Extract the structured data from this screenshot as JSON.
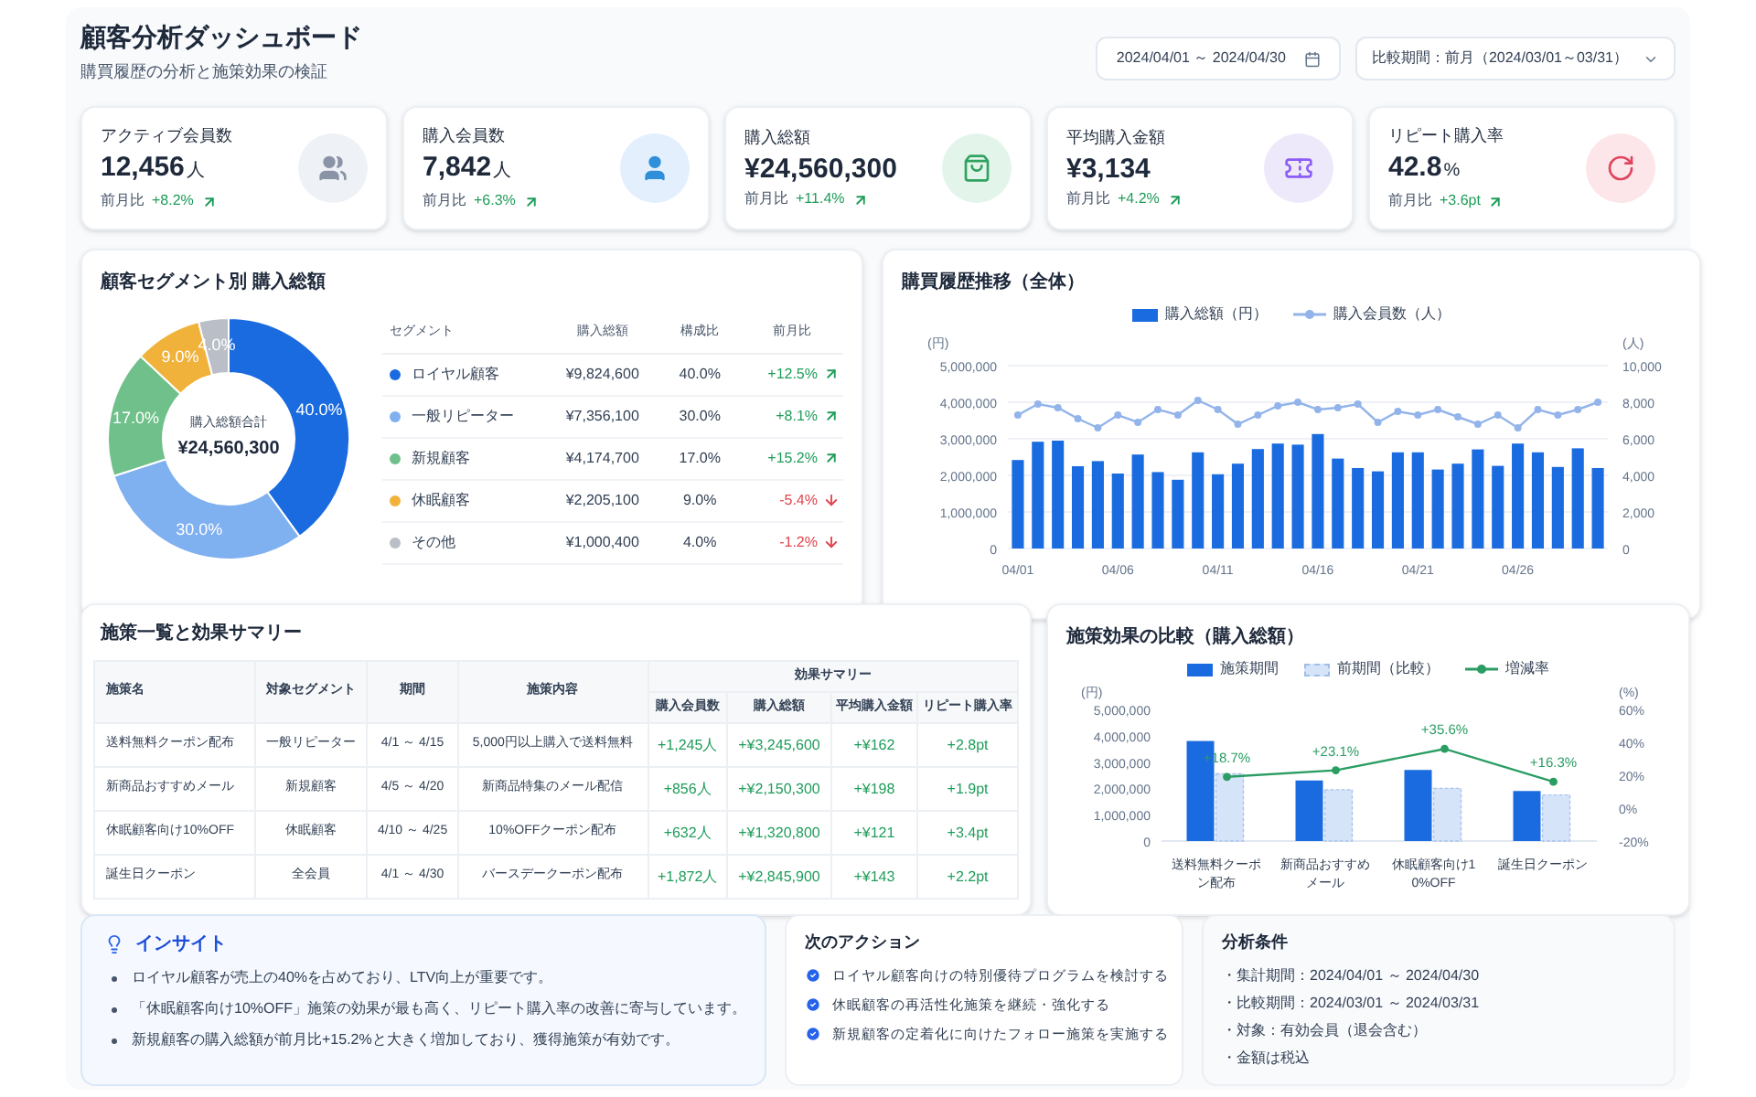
{
  "header": {
    "title": "顧客分析ダッシュボード",
    "subtitle": "購買履歴の分析と施策効果の検証",
    "date_range": "2024/04/01 ～ 2024/04/30",
    "compare_period": "比較期間：前月（2024/03/01～03/31）"
  },
  "kpis": [
    {
      "label": "アクティブ会員数",
      "value": "12,456",
      "unit": "人",
      "compare_label": "前月比",
      "change": "+8.2%",
      "up": true
    },
    {
      "label": "購入会員数",
      "value": "7,842",
      "unit": "人",
      "compare_label": "前月比",
      "change": "+6.3%",
      "up": true
    },
    {
      "label": "購入総額",
      "value": "¥24,560,300",
      "compare_label": "前月比",
      "change": "+11.4%",
      "up": true
    },
    {
      "label": "平均購入金額",
      "value": "¥3,134",
      "compare_label": "前月比",
      "change": "+4.2%",
      "up": true
    },
    {
      "label": "リピート購入率",
      "value": "42.8",
      "unit": "%",
      "compare_label": "前月比",
      "change": "+3.6pt",
      "up": true
    }
  ],
  "segments": {
    "title": "顧客セグメント別 購入総額",
    "center_label": "購入総額合計",
    "center_value": "¥24,560,300",
    "chart_data": {
      "type": "donut",
      "values": [
        40,
        30,
        17,
        9,
        4
      ],
      "value_labels": [
        "40.0%",
        "30.0%",
        "17.0%",
        "9.0%",
        "4.0%"
      ]
    },
    "columns": [
      "セグメント",
      "購入総額",
      "構成比",
      "前月比"
    ],
    "rows": [
      {
        "name": "ロイヤル顧客",
        "color": "#1a6be0",
        "amount": "¥9,824,600",
        "share": "40.0%",
        "change": "+12.5%",
        "up": true
      },
      {
        "name": "一般リピーター",
        "color": "#7fb0f0",
        "amount": "¥7,356,100",
        "share": "30.0%",
        "change": "+8.1%",
        "up": true
      },
      {
        "name": "新規顧客",
        "color": "#6fc08a",
        "amount": "¥4,174,700",
        "share": "17.0%",
        "change": "+15.2%",
        "up": true
      },
      {
        "name": "休眠顧客",
        "color": "#f0b23a",
        "amount": "¥2,205,100",
        "share": "9.0%",
        "change": "-5.4%",
        "up": false
      },
      {
        "name": "その他",
        "color": "#b9bec7",
        "amount": "¥1,000,400",
        "share": "4.0%",
        "change": "-1.2%",
        "up": false
      }
    ]
  },
  "trend": {
    "title": "購買履歴推移（全体）",
    "chart_data": {
      "type": "bar",
      "ylabel": "(円)",
      "y2label": "(人)",
      "grid": true,
      "categories": [
        "04/01",
        null,
        null,
        null,
        null,
        "04/06",
        null,
        null,
        null,
        null,
        "04/11",
        null,
        null,
        null,
        null,
        "04/16",
        null,
        null,
        null,
        null,
        "04/21",
        null,
        null,
        null,
        null,
        "04/26",
        null,
        null,
        null,
        null
      ],
      "ylim": [
        0,
        5000000
      ],
      "yticks": [
        {
          "value": 0,
          "label": "0"
        },
        {
          "value": 1000000,
          "label": "1,000,000"
        },
        {
          "value": 2000000,
          "label": "2,000,000"
        },
        {
          "value": 3000000,
          "label": "3,000,000"
        },
        {
          "value": 4000000,
          "label": "4,000,000"
        },
        {
          "value": 5000000,
          "label": "5,000,000"
        }
      ],
      "y2lim": [
        0,
        10000
      ],
      "y2ticks": [
        {
          "value": 0,
          "label": "0"
        },
        {
          "value": 2000,
          "label": "2,000"
        },
        {
          "value": 4000,
          "label": "4,000"
        },
        {
          "value": 6000,
          "label": "6,000"
        },
        {
          "value": 8000,
          "label": "8,000"
        },
        {
          "value": 10000,
          "label": "10,000"
        }
      ],
      "series": [
        {
          "name": "購入総額（円）",
          "color": "#1a6be0",
          "values": [
            2420000,
            2920000,
            2950000,
            2250000,
            2390000,
            2050000,
            2570000,
            2090000,
            1880000,
            2630000,
            2030000,
            2320000,
            2720000,
            2870000,
            2840000,
            3130000,
            2460000,
            2200000,
            2110000,
            2630000,
            2630000,
            2160000,
            2320000,
            2710000,
            2260000,
            2870000,
            2630000,
            2230000,
            2740000,
            2200000
          ]
        },
        {
          "name": "購入会員数（人）",
          "color": "#93b4ea",
          "type": "line",
          "axis": "y2",
          "marker": true,
          "values": [
            7300,
            7900,
            7700,
            7100,
            6600,
            7300,
            6900,
            7600,
            7300,
            8100,
            7600,
            6800,
            7300,
            7800,
            8000,
            7600,
            7700,
            7900,
            6900,
            7500,
            7300,
            7600,
            7200,
            6800,
            7300,
            6600,
            7600,
            7300,
            7600,
            8000
          ]
        }
      ]
    }
  },
  "measures": {
    "title": "施策一覧と効果サマリー",
    "columns": [
      "施策名",
      "対象セグメント",
      "期間",
      "施策内容"
    ],
    "group": {
      "label": "効果サマリー",
      "columns": [
        "購入会員数",
        "購入総額",
        "平均購入金額",
        "リピート購入率"
      ]
    },
    "rows": [
      {
        "cells": [
          "送料無料クーポン配布",
          "一般リピーター",
          "4/1 ～ 4/15",
          "5,000円以上購入で送料無料",
          "+1,245人",
          "+¥3,245,600",
          "+¥162",
          "+2.8pt"
        ]
      },
      {
        "cells": [
          "新商品おすすめメール",
          "新規顧客",
          "4/5 ～ 4/20",
          "新商品特集のメール配信",
          "+856人",
          "+¥2,150,300",
          "+¥198",
          "+1.9pt"
        ]
      },
      {
        "cells": [
          "休眠顧客向け10%OFF",
          "休眠顧客",
          "4/10 ～ 4/25",
          "10%OFFクーポン配布",
          "+632人",
          "+¥1,320,800",
          "+¥121",
          "+3.4pt"
        ]
      },
      {
        "cells": [
          "誕生日クーポン",
          "全会員",
          "4/1 ～ 4/30",
          "バースデークーポン配布",
          "+1,872人",
          "+¥2,845,900",
          "+¥143",
          "+2.2pt"
        ]
      }
    ]
  },
  "comparison": {
    "title": "施策効果の比較（購入総額）",
    "chart_data": {
      "type": "bar",
      "ylabel": "(円)",
      "y2label": "(%)",
      "categories": [
        "送料無料クーポン配布",
        "新商品おすすめメール",
        "休眠顧客向け10%OFF",
        "誕生日クーポン"
      ],
      "ylim": [
        0,
        5000000
      ],
      "yticks": [
        {
          "value": 0,
          "label": "0"
        },
        {
          "value": 1000000,
          "label": "1,000,000"
        },
        {
          "value": 2000000,
          "label": "2,000,000"
        },
        {
          "value": 3000000,
          "label": "3,000,000"
        },
        {
          "value": 4000000,
          "label": "4,000,000"
        },
        {
          "value": 5000000,
          "label": "5,000,000"
        }
      ],
      "y2lim": [
        -20,
        60
      ],
      "y2ticks": [
        {
          "value": -20,
          "label": "-20%"
        },
        {
          "value": 0,
          "label": "0%"
        },
        {
          "value": 20,
          "label": "20%"
        },
        {
          "value": 40,
          "label": "40%"
        },
        {
          "value": 60,
          "label": "60%"
        }
      ],
      "value_labels": [
        "+18.7%",
        "+23.1%",
        "+35.6%",
        "+16.3%"
      ],
      "series": [
        {
          "name": "施策期間",
          "color": "#1a6be0",
          "values": [
            3800000,
            2300000,
            2700000,
            1900000
          ]
        },
        {
          "name": "前期間（比較）",
          "color": "#d6e4fa",
          "values": [
            2550000,
            1950000,
            2000000,
            1750000
          ]
        },
        {
          "name": "増減率",
          "color": "#2a9d63",
          "type": "line",
          "axis": "y2",
          "marker": true,
          "values": [
            19,
            23,
            36,
            16
          ]
        }
      ]
    }
  },
  "insight": {
    "title": "インサイト",
    "items": [
      "ロイヤル顧客が売上の40%を占めており、LTV向上が重要です。",
      "「休眠顧客向け10%OFF」施策の効果が最も高く、リピート購入率の改善に寄与しています。",
      "新規顧客の購入総額が前月比+15.2%と大きく増加しており、獲得施策が有効です。"
    ]
  },
  "actions": {
    "title": "次のアクション",
    "items": [
      "ロイヤル顧客向けの特別優待プログラムを検討する",
      "休眠顧客の再活性化施策を継続・強化する",
      "新規顧客の定着化に向けたフォロー施策を実施する"
    ]
  },
  "conditions": {
    "title": "分析条件",
    "items": [
      "・集計期間：2024/04/01 ～ 2024/04/30",
      "・比較期間：2024/03/01 ～ 2024/03/31",
      "・対象：有効会員（退会含む）",
      "・金額は税込"
    ]
  }
}
